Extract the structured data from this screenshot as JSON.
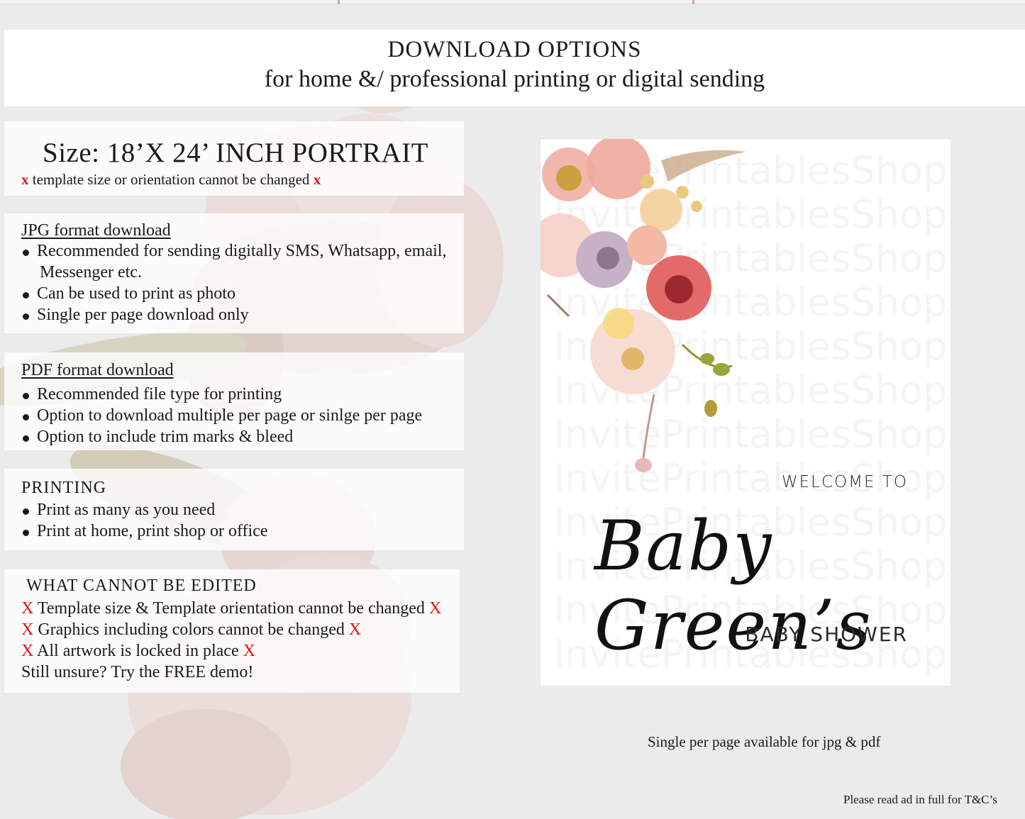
{
  "header": {
    "title": "DOWNLOAD OPTIONS",
    "subtitle": "for home &/ professional printing or digital sending"
  },
  "size": {
    "title": "Size: 18’X 24’ INCH PORTRAIT",
    "mark": "x",
    "note": "template size or orientation cannot be changed"
  },
  "jpg": {
    "title": "JPG format download",
    "items": [
      "Recommended for sending digitally SMS, Whatsapp, email,",
      "Messenger etc.",
      "Can be used to print as photo",
      "Single per page download only"
    ]
  },
  "pdf": {
    "title": "PDF format download",
    "items": [
      "Recommended file type for printing",
      "Option to download multiple per page or sinlge per page",
      "Option to include trim marks & bleed"
    ]
  },
  "printing": {
    "title": "PRINTING",
    "items": [
      "Print as many as you need",
      "Print at home, print shop or office"
    ]
  },
  "not_editable": {
    "title": "WHAT CANNOT BE EDITED",
    "mark": "X",
    "items": [
      "Template size & Template orientation cannot be changed",
      "Graphics including colors cannot be changed",
      "All artwork is locked in place"
    ],
    "demo": "Still unsure? Try the FREE demo!"
  },
  "sign": {
    "watermark": "InvitePrintablesShop",
    "welcome": "WELCOME TO",
    "name": "Baby Green’s",
    "event": "BABY SHOWER"
  },
  "notes": {
    "availability": "Single per page available for jpg & pdf",
    "terms": "Please read ad in full for T&C’s"
  },
  "colors": {
    "mark_red": "#e0141b",
    "background": "#ebebec",
    "panel": "#ffffff"
  }
}
